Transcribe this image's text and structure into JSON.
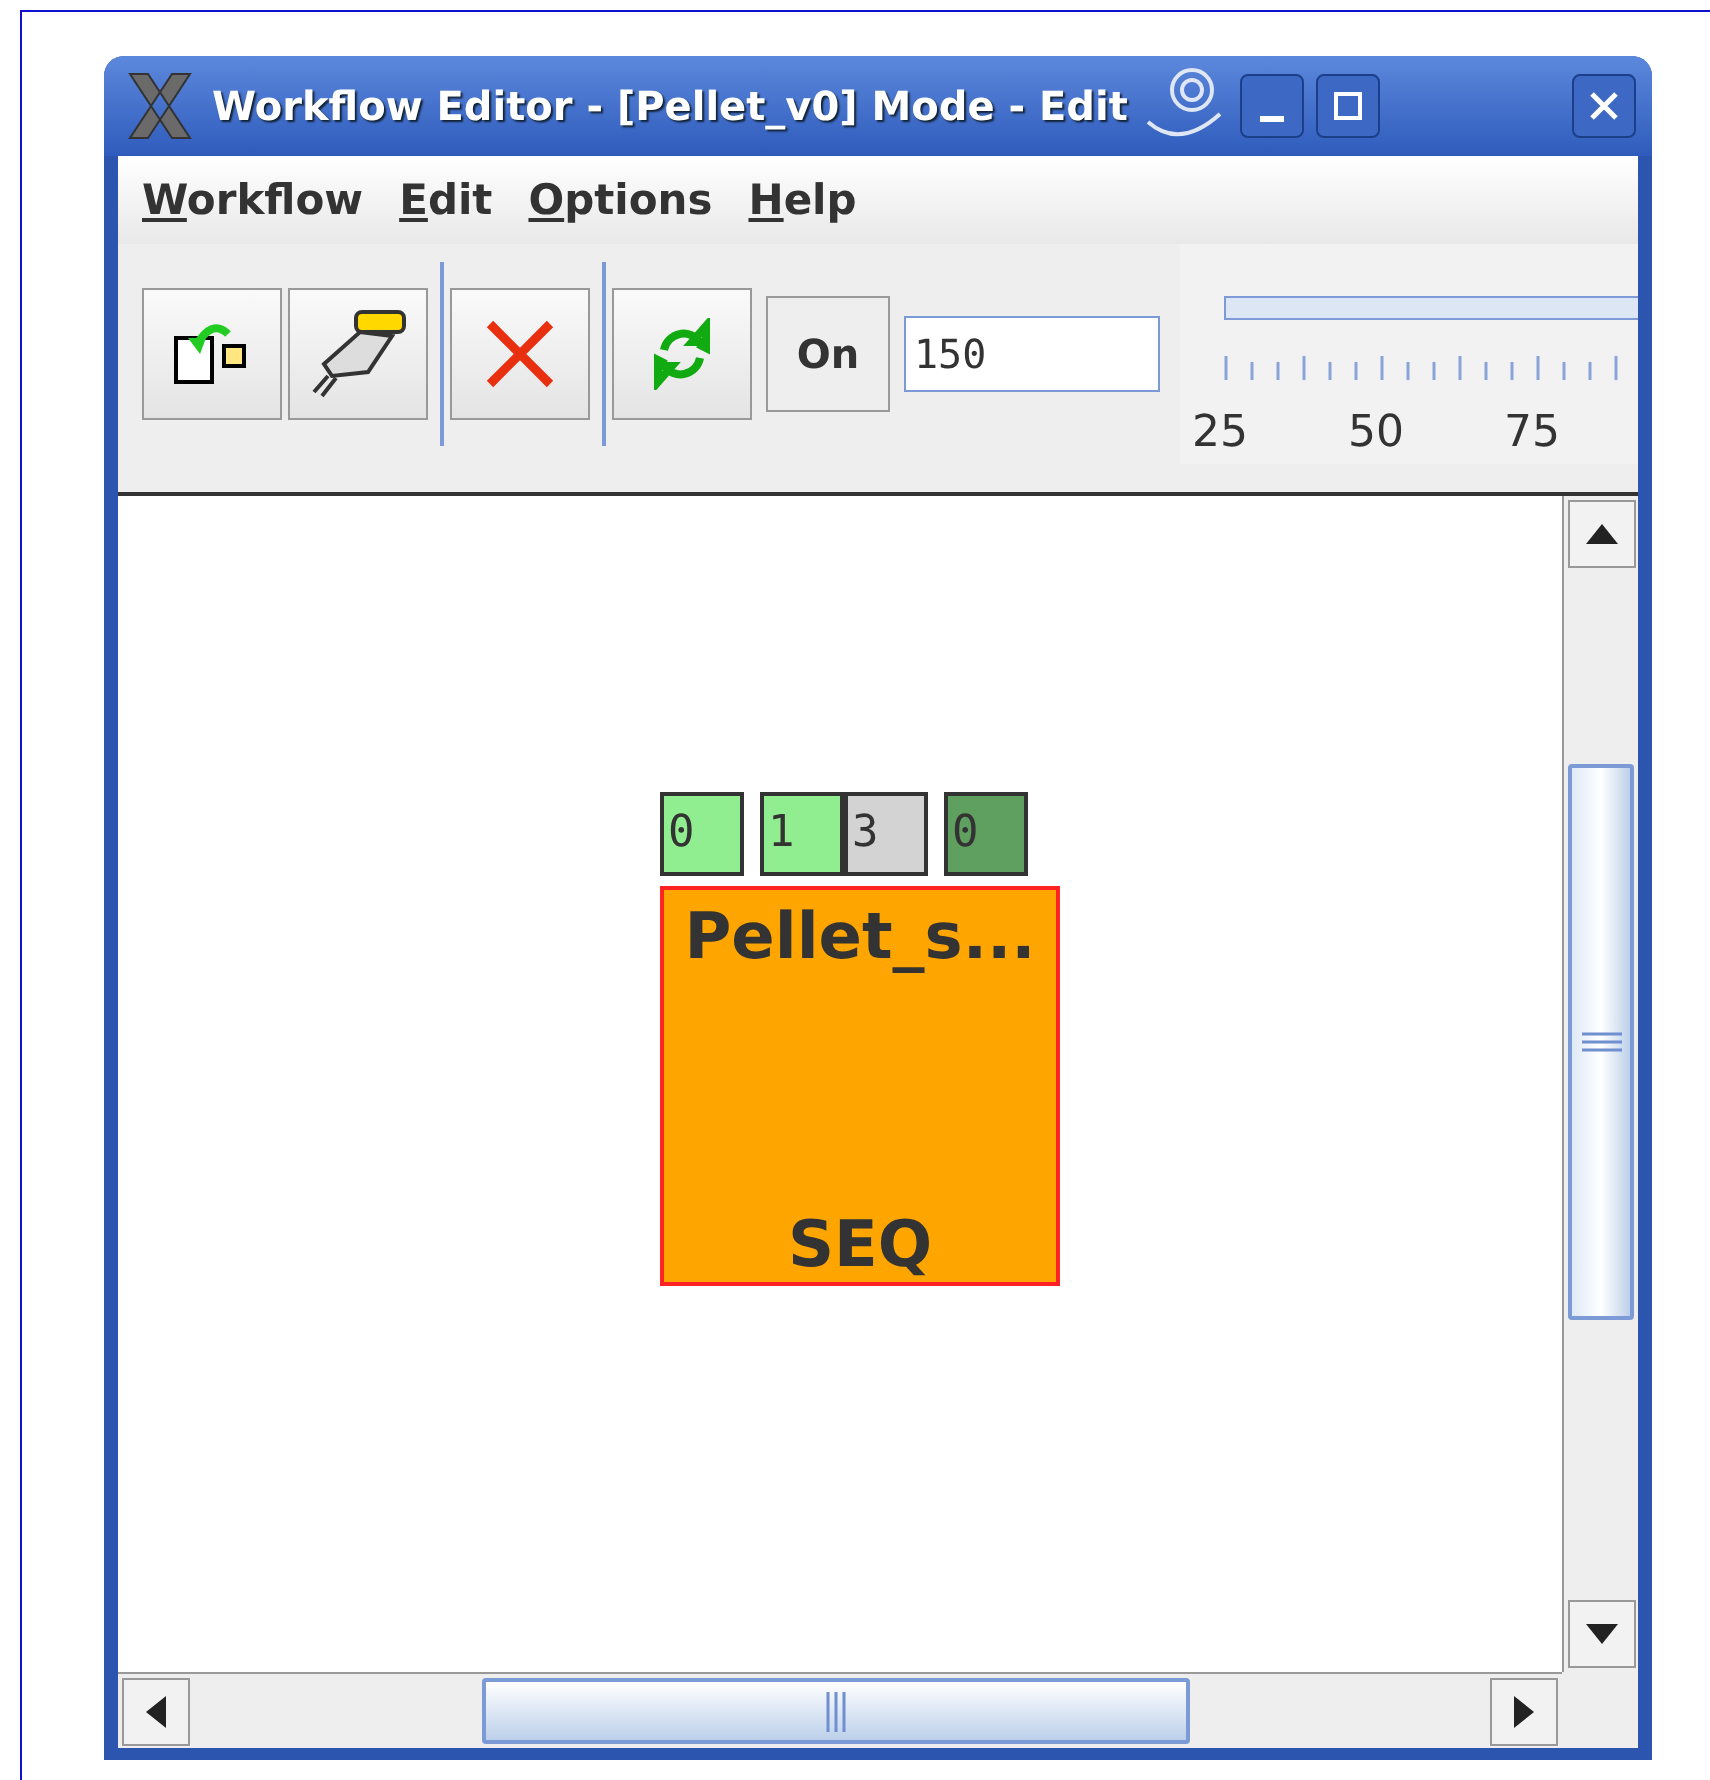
{
  "window": {
    "title": "Workflow Editor - [Pellet_v0]  Mode - Edit"
  },
  "menu": [
    {
      "underlined": "W",
      "rest": "orkflow"
    },
    {
      "underlined": "E",
      "rest": "dit"
    },
    {
      "underlined": "O",
      "rest": "ptions"
    },
    {
      "underlined": "H",
      "rest": "elp"
    }
  ],
  "toolbar": {
    "toggle_label": "On",
    "zoom_value": "150",
    "zoom_ticks": [
      "25",
      "50",
      "75"
    ]
  },
  "node": {
    "title": "Pellet_s...",
    "type": "SEQ",
    "ports": [
      {
        "label": "0",
        "color": "#90ee90"
      },
      {
        "label": "1",
        "color": "#90ee90"
      },
      {
        "label": "3",
        "color": "#d3d3d3"
      },
      {
        "label": "0",
        "color": "#5f9f5f"
      }
    ]
  }
}
